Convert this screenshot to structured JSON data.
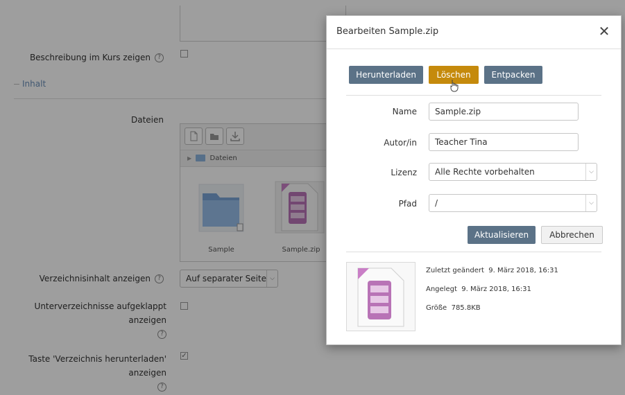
{
  "form": {
    "show_description_label": "Beschreibung im Kurs zeigen",
    "section_content": "Inhalt",
    "files_label": "Dateien",
    "file_path": "Dateien",
    "items": [
      {
        "name": "Sample"
      },
      {
        "name": "Sample.zip"
      }
    ],
    "display_label": "Verzeichnisinhalt anzeigen",
    "display_value": "Auf separater Seite",
    "subfolders_label_1": "Unterverzeichnisse aufgeklappt",
    "subfolders_label_2": "anzeigen",
    "download_btn_label_1": "Taste 'Verzeichnis herunterladen'",
    "download_btn_label_2": "anzeigen",
    "help_glyph": "?",
    "check_glyph": "✓"
  },
  "dialog": {
    "title": "Bearbeiten Sample.zip",
    "close_glyph": "✕",
    "buttons": {
      "download": "Herunterladen",
      "delete": "Löschen",
      "unzip": "Entpacken",
      "update": "Aktualisieren",
      "cancel": "Abbrechen"
    },
    "fields": {
      "name_label": "Name",
      "name_value": "Sample.zip",
      "author_label": "Autor/in",
      "author_value": "Teacher Tina",
      "license_label": "Lizenz",
      "license_value": "Alle Rechte vorbehalten",
      "path_label": "Pfad",
      "path_value": "/"
    },
    "meta": {
      "modified_label": "Zuletzt geändert",
      "modified_value": "9. März 2018, 16:31",
      "created_label": "Angelegt",
      "created_value": "9. März 2018, 16:31",
      "size_label": "Größe",
      "size_value": "785.8KB"
    }
  },
  "colors": {
    "button_grey": "#5b7287",
    "button_orange": "#c58a0c",
    "link_blue": "#6a8fb8"
  }
}
